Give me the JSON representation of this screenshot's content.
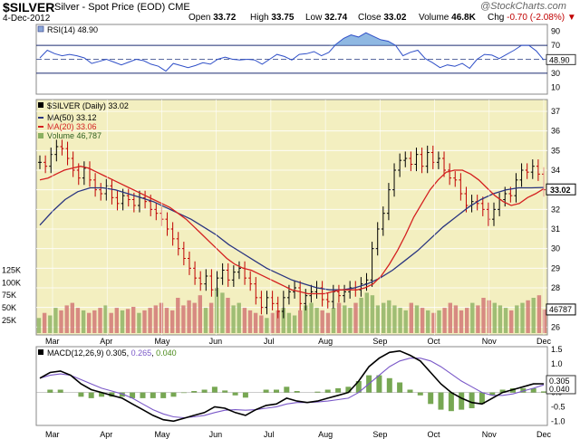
{
  "header": {
    "symbol": "$SILVER",
    "name": "Silver - Spot Price (EOD)",
    "exchange": "CME",
    "source": "@StockCharts.com",
    "date": "4-Dec-2012",
    "open_label": "Open",
    "open": "33.72",
    "high_label": "High",
    "high": "33.75",
    "low_label": "Low",
    "low": "32.74",
    "close_label": "Close",
    "close": "33.02",
    "volume_label": "Volume",
    "volume": "46.8K",
    "chg_label": "Chg",
    "chg": "-0.70 (-2.08%)",
    "chg_arrow": "▼"
  },
  "colors": {
    "price_bg": "#f3efc0",
    "up": "#000000",
    "down": "#c00000",
    "ma50": "#2a3580",
    "ma20": "#d42020",
    "rsi": "#3050c8",
    "macd": "#000000",
    "signal": "#7a58c8",
    "hist": "#4a8a1a",
    "vol_up": "#8ab060",
    "vol_down": "#d07070"
  },
  "x_months": [
    "Mar",
    "Apr",
    "May",
    "Jun",
    "Jul",
    "Aug",
    "Sep",
    "Oct",
    "Nov",
    "Dec"
  ],
  "chart_data": [
    {
      "type": "line",
      "panel": "rsi",
      "legend": "RSI(14) 48.90",
      "ylim": [
        0,
        100
      ],
      "y_ticks": [
        "90",
        "70",
        "50",
        "30",
        "10"
      ],
      "bands": [
        30,
        70
      ],
      "last_label": "48.90",
      "values": [
        52,
        63,
        58,
        55,
        57,
        55,
        52,
        44,
        47,
        50,
        46,
        42,
        46,
        50,
        48,
        43,
        40,
        33,
        44,
        41,
        38,
        41,
        45,
        43,
        50,
        53,
        50,
        49,
        50,
        49,
        43,
        50,
        57,
        54,
        49,
        57,
        58,
        61,
        55,
        60,
        72,
        80,
        85,
        82,
        88,
        83,
        78,
        76,
        70,
        55,
        60,
        63,
        51,
        45,
        38,
        42,
        40,
        44,
        37,
        50,
        57,
        56,
        51,
        57,
        63,
        70,
        70,
        62,
        48.9
      ]
    },
    {
      "type": "line",
      "panel": "price",
      "legend": "$SILVER (Daily) 33.02",
      "legend_ma50": "MA(50) 33.12",
      "legend_ma20": "MA(20) 33.06",
      "legend_volume": "Volume 46,787",
      "ylim": [
        25.6,
        37.6
      ],
      "y_ticks": [
        "37",
        "36",
        "35",
        "34",
        "33",
        "32",
        "31",
        "30",
        "29",
        "28",
        "27",
        "26"
      ],
      "last_price_label": "33.02",
      "last_volume_label": "46787",
      "volume_ticks": [
        "125K",
        "100K",
        "75K",
        "50K",
        "25K"
      ],
      "volume_max": 140,
      "prices": [
        34.4,
        34.2,
        34.8,
        35.2,
        35.1,
        34.6,
        34.0,
        33.6,
        34.1,
        33.5,
        33.0,
        32.8,
        33.2,
        32.6,
        32.3,
        32.7,
        32.5,
        32.2,
        32.6,
        32.4,
        32.0,
        31.8,
        31.5,
        31.0,
        30.5,
        30.0,
        29.5,
        29.0,
        28.5,
        28.2,
        28.6,
        27.9,
        28.5,
        28.9,
        28.4,
        28.8,
        29.0,
        28.5,
        28.2,
        27.5,
        27.0,
        27.5,
        27.2,
        26.8,
        27.5,
        27.8,
        28.0,
        27.2,
        27.6,
        27.8,
        28.0,
        27.4,
        27.3,
        27.8,
        27.6,
        27.8,
        28.0,
        27.9,
        28.2,
        28.4,
        30.0,
        31.0,
        31.8,
        33.0,
        34.0,
        34.5,
        34.6,
        34.3,
        34.8,
        34.2,
        34.9,
        34.4,
        34.6,
        34.0,
        33.6,
        33.5,
        32.8,
        32.2,
        32.4,
        32.3,
        32.0,
        31.5,
        32.0,
        32.5,
        32.8,
        32.7,
        33.5,
        34.0,
        33.9,
        34.2,
        33.8,
        33.0
      ],
      "ma20": [
        33.5,
        33.6,
        33.8,
        34.0,
        34.1,
        34.2,
        34.1,
        33.9,
        33.7,
        33.5,
        33.3,
        33.1,
        32.9,
        32.7,
        32.5,
        32.3,
        32.1,
        31.8,
        31.5,
        31.1,
        30.7,
        30.3,
        29.9,
        29.5,
        29.2,
        29.0,
        28.9,
        28.7,
        28.5,
        28.3,
        28.1,
        27.9,
        27.8,
        27.7,
        27.7,
        27.7,
        27.8,
        27.9,
        27.9,
        27.9,
        28.0,
        28.2,
        28.6,
        29.2,
        29.9,
        30.7,
        31.6,
        32.3,
        33.0,
        33.5,
        33.9,
        34.0,
        34.0,
        33.8,
        33.5,
        33.1,
        32.7,
        32.4,
        32.2,
        32.3,
        32.6,
        32.8,
        33.06
      ],
      "ma50": [
        31.2,
        31.9,
        32.5,
        32.9,
        33.1,
        33.1,
        33.0,
        32.8,
        32.6,
        32.4,
        32.1,
        31.8,
        31.5,
        31.1,
        30.7,
        30.2,
        29.8,
        29.4,
        29.0,
        28.7,
        28.4,
        28.2,
        28.0,
        27.9,
        27.9,
        28.0,
        28.2,
        28.5,
        28.9,
        29.4,
        29.9,
        30.5,
        31.1,
        31.6,
        32.1,
        32.5,
        32.8,
        33.0,
        33.1,
        33.1,
        33.12
      ],
      "volumes": [
        30,
        40,
        35,
        50,
        45,
        55,
        60,
        50,
        45,
        40,
        45,
        50,
        55,
        40,
        50,
        45,
        48,
        52,
        40,
        45,
        50,
        55,
        60,
        50,
        45,
        70,
        55,
        65,
        60,
        75,
        50,
        60,
        90,
        80,
        70,
        55,
        60,
        50,
        45,
        40,
        35,
        30,
        40,
        45,
        50,
        40,
        35,
        45,
        55,
        60,
        50,
        45,
        40,
        50,
        60,
        55,
        50,
        60,
        70,
        80,
        75,
        55,
        60,
        65,
        55,
        50,
        45,
        60,
        55,
        50,
        45,
        40,
        45,
        50,
        60,
        55,
        45,
        50,
        60,
        55,
        70,
        65,
        60,
        55,
        50,
        45,
        55,
        60,
        65,
        70,
        75,
        46.8
      ]
    },
    {
      "type": "line",
      "panel": "macd",
      "legend_prefix": "MACD(12,26,9)",
      "legend_macd": "0.305",
      "legend_signal": "0.265",
      "legend_hist": "0.040",
      "ylim": [
        -1.15,
        1.6
      ],
      "y_ticks": [
        "1.5",
        "1.0",
        "0.5",
        "0.0",
        "-0.5",
        "-1.0"
      ],
      "macd": [
        0.5,
        0.7,
        0.75,
        0.6,
        0.3,
        0.1,
        0.0,
        -0.1,
        -0.2,
        -0.4,
        -0.6,
        -0.8,
        -0.95,
        -1.0,
        -0.9,
        -0.8,
        -0.7,
        -0.5,
        -0.55,
        -0.7,
        -0.8,
        -0.6,
        -0.45,
        -0.4,
        -0.2,
        -0.3,
        -0.35,
        -0.3,
        -0.2,
        -0.1,
        0.0,
        0.4,
        0.9,
        1.2,
        1.4,
        1.45,
        1.3,
        1.1,
        0.7,
        0.3,
        0.0,
        -0.2,
        -0.35,
        -0.4,
        -0.2,
        0.0,
        0.1,
        0.2,
        0.3,
        0.305
      ],
      "signal": [
        0.5,
        0.6,
        0.65,
        0.6,
        0.45,
        0.3,
        0.15,
        0.05,
        -0.05,
        -0.2,
        -0.4,
        -0.6,
        -0.75,
        -0.85,
        -0.88,
        -0.85,
        -0.8,
        -0.7,
        -0.62,
        -0.6,
        -0.62,
        -0.6,
        -0.55,
        -0.5,
        -0.4,
        -0.35,
        -0.35,
        -0.33,
        -0.3,
        -0.25,
        -0.2,
        0.0,
        0.3,
        0.6,
        0.9,
        1.1,
        1.2,
        1.2,
        1.1,
        0.9,
        0.65,
        0.4,
        0.2,
        0.0,
        -0.1,
        -0.1,
        -0.05,
        0.05,
        0.15,
        0.265
      ],
      "last_labels": [
        "0.305",
        "0.040"
      ]
    }
  ]
}
